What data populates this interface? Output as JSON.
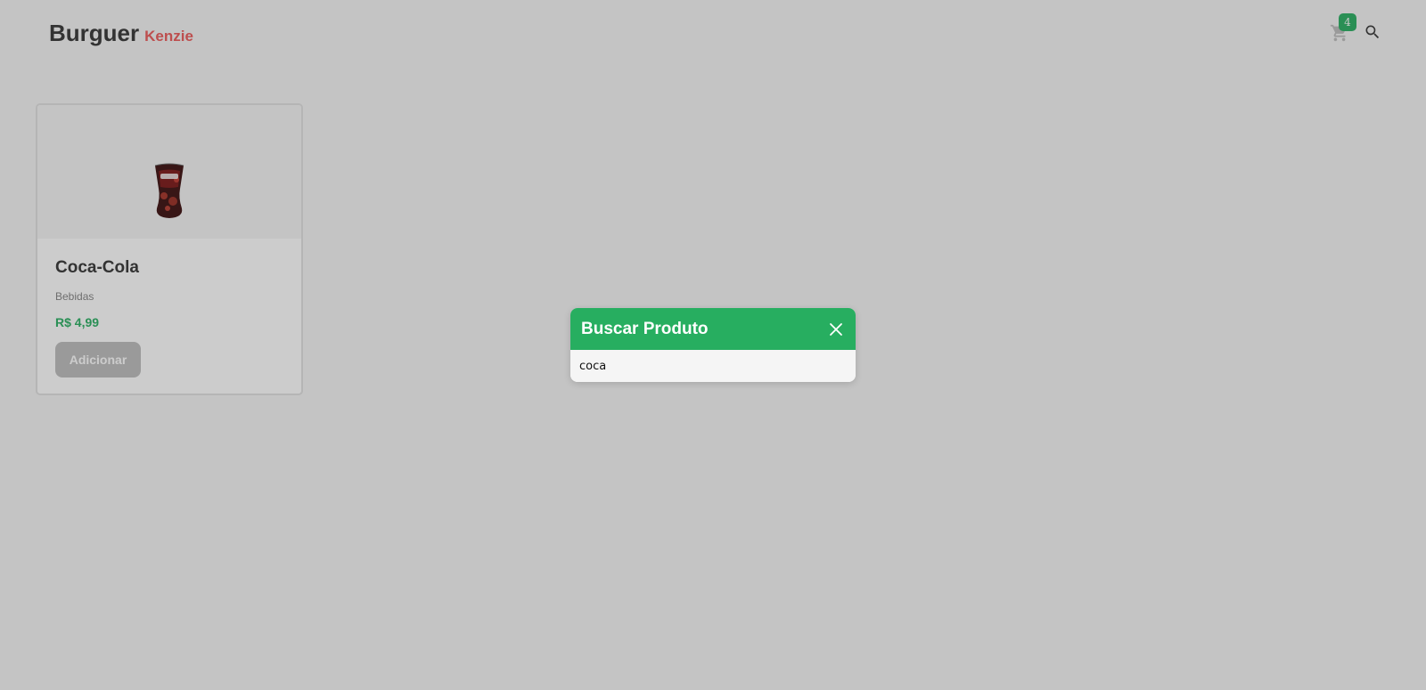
{
  "header": {
    "logo_main": "Burguer",
    "logo_sub": "Kenzie",
    "cart_count": "4"
  },
  "products": [
    {
      "name": "Coca-Cola",
      "category": "Bebidas",
      "price": "R$ 4,99",
      "button_label": "Adicionar",
      "image_icon": "soda-glass-icon"
    }
  ],
  "modal": {
    "title": "Buscar Produto",
    "search_value": "coca"
  },
  "colors": {
    "primary_green": "#27ae60",
    "secondary_red": "#eb5757",
    "background": "#f5f5f5"
  }
}
